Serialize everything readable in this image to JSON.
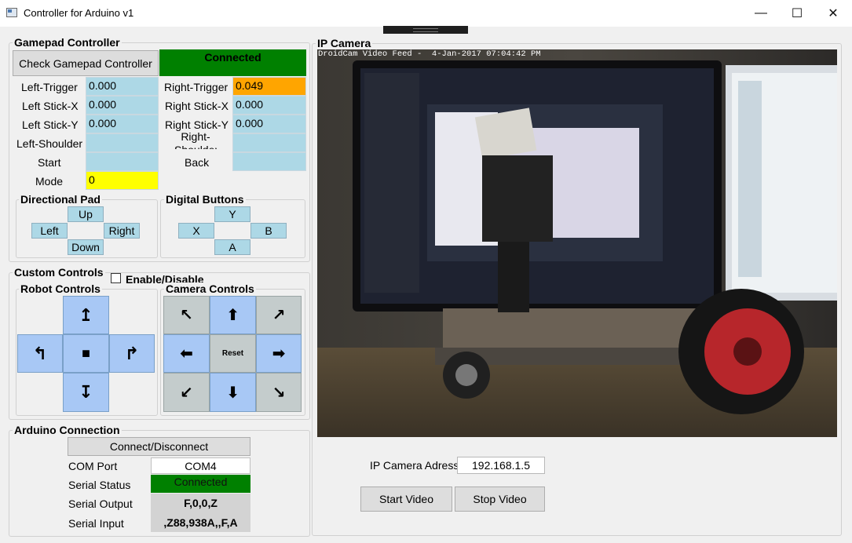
{
  "window": {
    "title": "Controller for Arduino v1",
    "minimize": "—",
    "maximize": "☐",
    "close": "✕"
  },
  "gamepad": {
    "title": "Gamepad Controller",
    "check_button": "Check Gamepad Controller",
    "status": "Connected",
    "status_color": "#008000",
    "left_trigger_label": "Left-Trigger",
    "left_trigger": "0.000",
    "left_stick_x_label": "Left Stick-X",
    "left_stick_x": "0.000",
    "left_stick_y_label": "Left Stick-Y",
    "left_stick_y": "0.000",
    "left_shoulder_label": "Left-Shoulder",
    "left_shoulder": "",
    "start_label": "Start",
    "start": "",
    "mode_label": "Mode",
    "mode": "0",
    "right_trigger_label": "Right-Trigger",
    "right_trigger": "0.049",
    "right_stick_x_label": "Right Stick-X",
    "right_stick_x": "0.000",
    "right_stick_y_label": "Right Stick-Y",
    "right_stick_y": "0.000",
    "right_shoulder_label": "Right-Shoulder",
    "right_shoulder": "",
    "back_label": "Back",
    "back": "",
    "right_trigger_color": "#ffa500",
    "mode_color": "#ffff00",
    "dpad": {
      "title": "Directional Pad",
      "up": "Up",
      "left": "Left",
      "right": "Right",
      "down": "Down"
    },
    "digital": {
      "title": "Digital Buttons",
      "y": "Y",
      "x": "X",
      "b": "B",
      "a": "A"
    }
  },
  "custom": {
    "title": "Custom Controls",
    "enable_label": "Enable/Disable",
    "enabled": false,
    "robot": {
      "title": "Robot Controls",
      "forward": "↥",
      "turn_left": "↰",
      "stop": "■",
      "turn_right": "↱",
      "backward": "↧"
    },
    "camera": {
      "title": "Camera Controls",
      "up_left": "↖",
      "up": "⬆",
      "up_right": "↗",
      "left": "⬅",
      "reset": "Reset",
      "right": "➡",
      "down_left": "↙",
      "down": "⬇",
      "down_right": "↘"
    }
  },
  "arduino": {
    "title": "Arduino Connection",
    "connect_button": "Connect/Disconnect",
    "com_port_label": "COM Port",
    "com_port": "COM4",
    "serial_status_label": "Serial Status",
    "serial_status": "Connected",
    "serial_output_label": "Serial Output",
    "serial_output": "F,0,0,Z",
    "serial_input_label": "Serial Input",
    "serial_input": ",Z88,938A,,F,A"
  },
  "ipcam": {
    "title": "IP Camera",
    "feed_caption": "DroidCam Video Feed -  4-Jan-2017 07:04:42 PM",
    "address_label": "IP Camera Adress",
    "address": "192.168.1.5",
    "start_button": "Start Video",
    "stop_button": "Stop Video"
  }
}
